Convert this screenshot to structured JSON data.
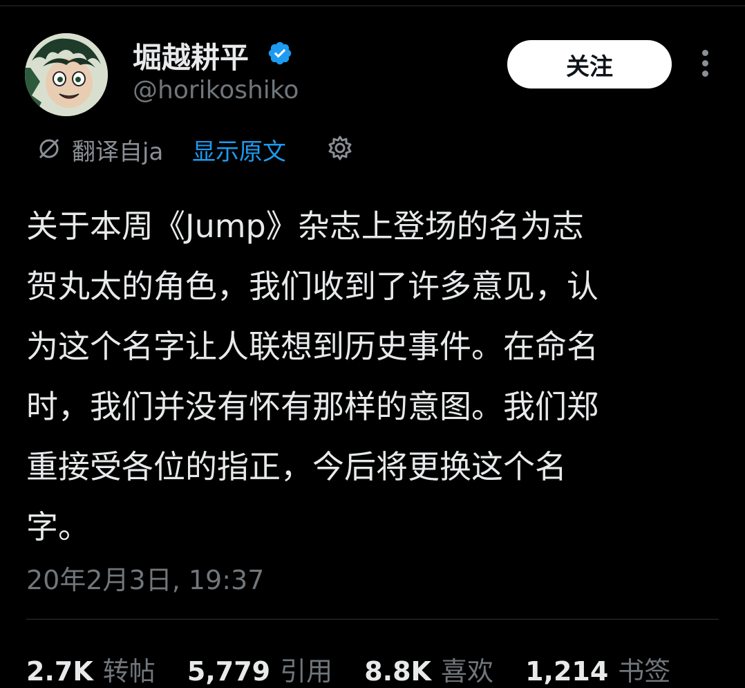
{
  "user": {
    "display_name": "堀越耕平",
    "handle": "@horikoshiko",
    "verified": true
  },
  "follow_label": "关注",
  "translation": {
    "label": "翻译自ja",
    "show_original": "显示原文"
  },
  "tweet": {
    "text": "关于本周《Jump》杂志上登场的名为志\n贺丸太的角色，我们收到了许多意见，认\n为这个名字让人联想到历史事件。在命名\n时，我们并没有怀有那样的意图。我们郑\n重接受各位的指正，今后将更换这个名\n字。",
    "timestamp": "20年2月3日, 19:37"
  },
  "stats": [
    {
      "value": "2.7K",
      "label": "转帖"
    },
    {
      "value": "5,779",
      "label": "引用"
    },
    {
      "value": "8.8K",
      "label": "喜欢"
    },
    {
      "value": "1,214",
      "label": "书签"
    }
  ],
  "colors": {
    "background": "#000000",
    "text": "#e7e9ea",
    "muted": "#71767b",
    "link": "#1d9bf0",
    "verified": "#1d9bf0"
  },
  "icons": [
    "verified-badge-icon",
    "more-options-icon",
    "translate-icon",
    "settings-icon"
  ]
}
